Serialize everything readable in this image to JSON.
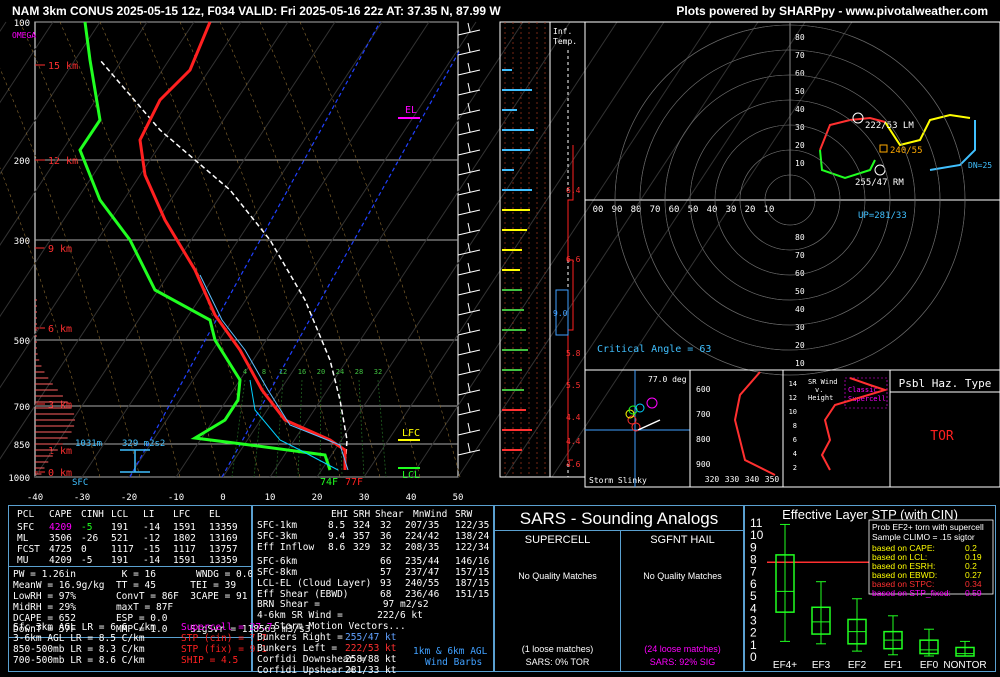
{
  "header": {
    "title": "NAM 3km CONUS 2025-05-15 12z, F034  VALID: Fri 2025-05-16 22z  AT: 37.35 N, 87.99 W",
    "credit": "Plots powered by SHARPpy - www.pivotalweather.com"
  },
  "skewt": {
    "omega_label": "OMEGA",
    "pressure_ticks": [
      "100",
      "200",
      "300",
      "500",
      "700",
      "850",
      "1000"
    ],
    "height_labels": [
      "15 km",
      "12 km",
      "9 km",
      "6 km",
      "3 km",
      "1 km",
      "0 km"
    ],
    "temp_ticks": [
      "-40",
      "-30",
      "-20",
      "-10",
      "0",
      "10",
      "20",
      "30",
      "40",
      "50"
    ],
    "mixing_ratio_ticks": [
      "4",
      "8",
      "12",
      "16",
      "20",
      "24",
      "28",
      "32"
    ],
    "el_label": "EL",
    "lfc_label": "LFC",
    "lcl_label": "LCL",
    "effective_layer": "1031m",
    "effective_srh": "329 m2s2",
    "sfc_label": "SFC",
    "sfc_td": "74F",
    "sfc_t": "77F"
  },
  "inferred_temp": {
    "label1": "Inf.",
    "label2": "Temp.",
    "values": [
      "6.4",
      "6.6",
      "9.0",
      "5.8",
      "5.5",
      "4.4",
      "4.4",
      "4.6"
    ]
  },
  "hodograph": {
    "y_ticks": [
      "80",
      "70",
      "60",
      "50",
      "40",
      "30",
      "20",
      "10"
    ],
    "x_ticks": [
      "00",
      "90",
      "80",
      "70",
      "60",
      "50",
      "40",
      "30",
      "20",
      "10"
    ],
    "lm": "222/53 LM",
    "mean": "240/55",
    "rm": "255/47 RM",
    "dn": "DN=25",
    "up": "UP=281/33"
  },
  "critical_angle": {
    "label": "Critical Angle = 63",
    "y_ticks": [
      "80",
      "70",
      "60",
      "50",
      "40",
      "30",
      "20",
      "10"
    ]
  },
  "storm_slinky": {
    "label": "Storm Slinky",
    "angle": "77.0 deg"
  },
  "theta_e": {
    "y_ticks": [
      "600",
      "700",
      "800",
      "900"
    ],
    "x_ticks": [
      "320",
      "330",
      "340",
      "350"
    ]
  },
  "sr_wind": {
    "label": "SR Wind",
    "label2": "v.",
    "label3": "Height",
    "y_ticks": [
      "14",
      "12",
      "10",
      "8",
      "6",
      "4",
      "2"
    ],
    "legend1": "Classic",
    "legend2": "Supercell"
  },
  "hazard": {
    "title": "Psbl Haz. Type",
    "value": "TOR"
  },
  "thermo": {
    "headers": [
      "PCL",
      "CAPE",
      "CINH",
      "LCL",
      "LI",
      "LFC",
      "EL"
    ],
    "rows": [
      [
        "SFC",
        "4209",
        "-5",
        "191",
        "-14",
        "1591",
        "13359"
      ],
      [
        "ML",
        "3506",
        "-26",
        "521",
        "-12",
        "1802",
        "13169"
      ],
      [
        "FCST",
        "4725",
        "0",
        "1117",
        "-15",
        "1117",
        "13757"
      ],
      [
        "MU",
        "4209",
        "-5",
        "191",
        "-14",
        "1591",
        "13359"
      ]
    ],
    "indices": [
      "PW = 1.26in        K = 16       WNDG = 0.0",
      "MeanW = 16.9g/kg  TT = 45      TEI = 39",
      "LowRH = 97%       ConvT = 86F  3CAPE = 91",
      "MidRH = 29%       maxT = 87F",
      "DCAPE = 652       ESP = 0.0",
      "DownT = 57F       MMP = 1.0    SigSvr = 118563 m3/s3"
    ],
    "lapse": [
      "Sfc-3km AGL LR = 6.6 C/km",
      "3-6km AGL LR = 8.5 C/km",
      "850-500mb LR = 8.3 C/km",
      "700-500mb LR = 8.6 C/km"
    ],
    "severe": [
      {
        "text": "Supercell = 27.7",
        "color": "#ff00ff"
      },
      {
        "text": "STP (cin) = 7.7",
        "color": "#ff2020"
      },
      {
        "text": "STP (fix) = 9.1",
        "color": "#ff2020"
      },
      {
        "text": "SHIP = 4.5",
        "color": "#ff2020"
      }
    ]
  },
  "kinematic": {
    "headers": [
      "EHI",
      "SRH",
      "Shear",
      "MnWind",
      "SRW"
    ],
    "rows": [
      [
        "SFC-1km",
        "8.5",
        "324",
        "32",
        "207/35",
        "122/35"
      ],
      [
        "SFC-3km",
        "9.4",
        "357",
        "36",
        "224/42",
        "138/24"
      ],
      [
        "Eff Inflow",
        "8.6",
        "329",
        "32",
        "208/35",
        "122/34"
      ],
      [
        "SFC-6km",
        "",
        "",
        "66",
        "235/44",
        "146/16"
      ],
      [
        "SFC-8km",
        "",
        "",
        "57",
        "237/47",
        "157/15"
      ],
      [
        "LCL-EL (Cloud Layer)",
        "",
        "",
        "93",
        "240/55",
        "187/15"
      ],
      [
        "Eff Shear (EBWD)",
        "",
        "",
        "68",
        "236/46",
        "151/15"
      ]
    ],
    "brn": "BRN Shear =           97 m2/s2",
    "srw46": "4-6km SR Wind =      222/6 kt",
    "motion_title": "...Storm Motion Vectors...",
    "motions": [
      {
        "label": "Bunkers Right =",
        "value": "255/47 kt",
        "color": "#60a0ff"
      },
      {
        "label": "Bunkers Left =",
        "value": "222/53 kt",
        "color": "#ff3030"
      },
      {
        "label": "Corfidi Downshear =",
        "value": "258/88 kt",
        "color": "#ffffff"
      },
      {
        "label": "Corfidi Upshear =",
        "value": "281/33 kt",
        "color": "#ffffff"
      }
    ],
    "barb_label1": "1km & 6km AGL",
    "barb_label2": "Wind Barbs"
  },
  "sars": {
    "title": "SARS - Sounding Analogs",
    "supercell": "SUPERCELL",
    "hail": "SGFNT HAIL",
    "sup_match": "No Quality Matches",
    "hail_match": "No Quality Matches",
    "sup_loose": "(1 loose matches)",
    "hail_loose": "(24 loose matches)",
    "sup_pct": "SARS: 0% TOR",
    "hail_pct": "SARS: 92% SIG"
  },
  "stp": {
    "title": "Effective Layer STP (with CIN)",
    "y_ticks": [
      "11",
      "10",
      "9",
      "8",
      "7",
      "6",
      "5",
      "4",
      "3",
      "2",
      "1",
      "0"
    ],
    "categories": [
      "EF4+",
      "EF3",
      "EF2",
      "EF1",
      "EF0",
      "NONTOR"
    ],
    "legend_title": "Prob EF2+ torn with supercell",
    "legend_sub": "Sample CLIMO = .15 sigtor",
    "legend": [
      {
        "label": "based on CAPE:",
        "value": "0.2",
        "color": "#ffff00"
      },
      {
        "label": "based on LCL:",
        "value": "0.19",
        "color": "#ffff00"
      },
      {
        "label": "based on ESRH:",
        "value": "0.2",
        "color": "#ffff00"
      },
      {
        "label": "based on EBWD:",
        "value": "0.27",
        "color": "#ffff00"
      },
      {
        "label": "based on STPC:",
        "value": "0.34",
        "color": "#ff3030"
      },
      {
        "label": "based on STP_fixed:",
        "value": "0.59",
        "color": "#ff00ff"
      }
    ]
  },
  "chart_data": [
    {
      "type": "box",
      "title": "Effective Layer STP (with CIN)",
      "categories": [
        "EF4+",
        "EF3",
        "EF2",
        "EF1",
        "EF0",
        "NONTOR"
      ],
      "boxes": [
        {
          "low": 1.2,
          "q1": 3.6,
          "median": 5.3,
          "q3": 8.3,
          "high": 10.8
        },
        {
          "low": 1.0,
          "q1": 1.8,
          "median": 2.8,
          "q3": 4.0,
          "high": 6.1
        },
        {
          "low": 0.4,
          "q1": 1.0,
          "median": 2.0,
          "q3": 3.0,
          "high": 4.7
        },
        {
          "low": 0.1,
          "q1": 0.6,
          "median": 1.3,
          "q3": 2.0,
          "high": 3.3
        },
        {
          "low": 0.0,
          "q1": 0.2,
          "median": 0.5,
          "q3": 1.3,
          "high": 2.2
        },
        {
          "low": 0.0,
          "q1": 0.0,
          "median": 0.2,
          "q3": 0.7,
          "high": 1.2
        }
      ],
      "marker": 7.7,
      "ylim": [
        0,
        11
      ]
    }
  ]
}
